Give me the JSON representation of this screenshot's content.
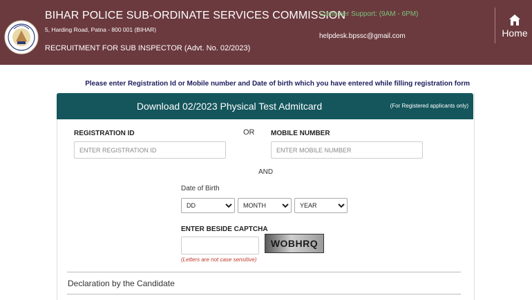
{
  "header": {
    "logo_text": "BPSSC",
    "title": "BIHAR POLICE SUB-ORDINATE SERVICES COMMISSION",
    "address": "5, Harding Road, Patna - 800 001 (BIHAR)",
    "recruitment": "RECRUITMENT FOR SUB INSPECTOR (Advt. No. 02/2023)",
    "support": "Customer Support: (9AM - 6PM)",
    "email": "helpdesk.bpssc@gmail.com",
    "home_label": "Home",
    "colors": {
      "bar": "#6b3a3e",
      "support_text": "#7cc27a"
    }
  },
  "instruction": "Please enter Registration Id or Mobile number and Date of birth which you have entered while filling registration form",
  "card": {
    "title": "Download 02/2023 Physical Test Admitcard",
    "note": "(For Registered applicants only)",
    "header_color": "#14565c"
  },
  "form": {
    "registration_label": "REGISTRATION ID",
    "registration_placeholder": "ENTER REGISTRATION ID",
    "or_text": "OR",
    "mobile_label": "MOBILE NUMBER",
    "mobile_placeholder": "ENTER MOBILE NUMBER",
    "and_text": "AND",
    "dob_label": "Date of Birth",
    "dob_day": "DD",
    "dob_month": "MONTH",
    "dob_year": "YEAR",
    "captcha_label": "ENTER BESIDE CAPTCHA",
    "captcha_value": "WOBHRQ",
    "captcha_note": "(Letters are not case sensitive)",
    "declaration": "Declaration by the Candidate"
  }
}
